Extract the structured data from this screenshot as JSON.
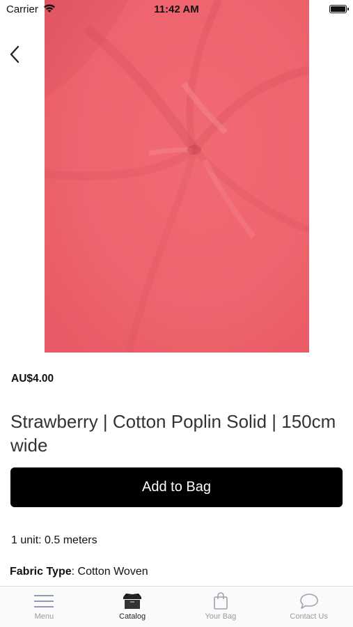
{
  "status_bar": {
    "carrier": "Carrier",
    "time": "11:42 AM"
  },
  "product": {
    "price": "AU$4.00",
    "title": "Strawberry | Cotton Poplin Solid | 150cm wide",
    "add_to_bag_label": "Add to Bag",
    "unit_info": "1 unit: 0.5 meters",
    "fabric_type_label": "Fabric Type",
    "fabric_type_value": ": Cotton Woven",
    "image_color": "#ef6670"
  },
  "tabs": [
    {
      "label": "Menu",
      "icon": "menu-icon",
      "active": false
    },
    {
      "label": "Catalog",
      "icon": "catalog-box-icon",
      "active": true
    },
    {
      "label": "Your Bag",
      "icon": "bag-icon",
      "active": false
    },
    {
      "label": "Contact Us",
      "icon": "chat-bubble-icon",
      "active": false
    }
  ],
  "colors": {
    "accent": "#000000",
    "tab_inactive": "#9a9a9a",
    "tab_active": "#222222"
  }
}
